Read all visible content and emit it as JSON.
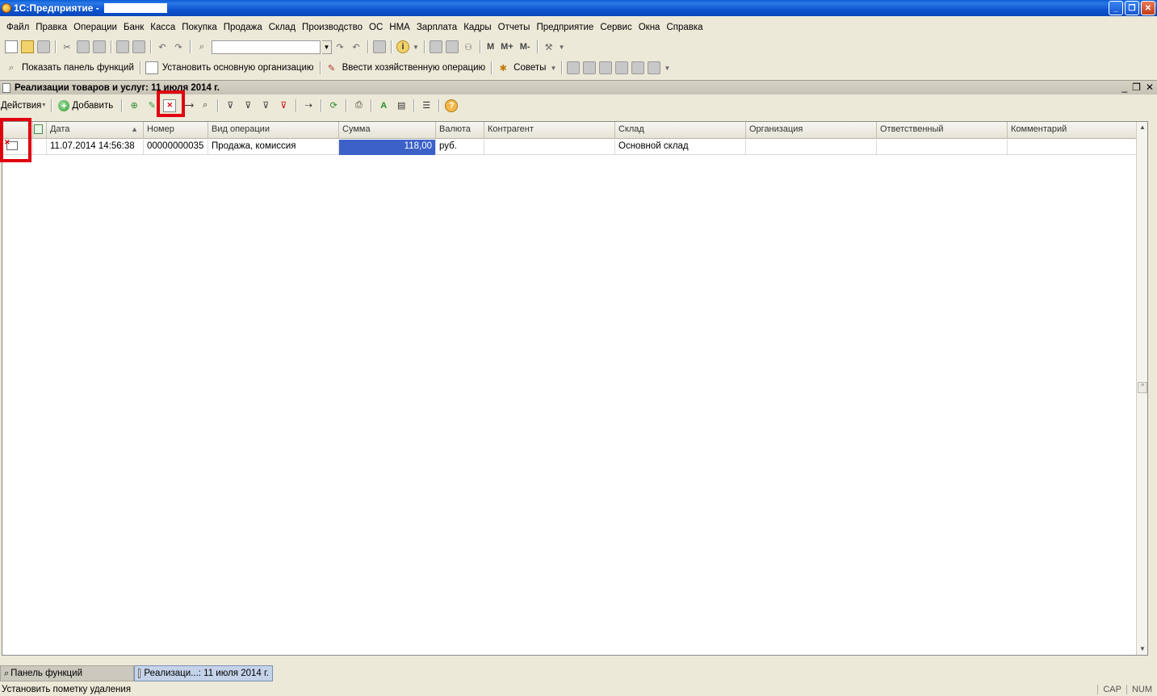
{
  "window": {
    "title": "1С:Предприятие -"
  },
  "menu": [
    "Файл",
    "Правка",
    "Операции",
    "Банк",
    "Касса",
    "Покупка",
    "Продажа",
    "Склад",
    "Производство",
    "ОС",
    "НМА",
    "Зарплата",
    "Кадры",
    "Отчеты",
    "Предприятие",
    "Сервис",
    "Окна",
    "Справка"
  ],
  "toolbar1": {
    "m": "M",
    "mplus": "M+",
    "mminus": "M-"
  },
  "toolbar2": {
    "show_panel": "Показать панель функций",
    "set_org": "Установить основную организацию",
    "enter_op": "Ввести хозяйственную операцию",
    "tips": "Советы"
  },
  "document": {
    "title": "Реализации товаров и услуг: 11 июля 2014 г."
  },
  "commandbar": {
    "actions": "Действия",
    "add": "Добавить"
  },
  "table": {
    "columns": [
      "Дата",
      "Номер",
      "Вид операции",
      "Сумма",
      "Валюта",
      "Контрагент",
      "Склад",
      "Организация",
      "Ответственный",
      "Комментарий"
    ],
    "rows": [
      {
        "date": "11.07.2014 14:56:38",
        "number": "00000000035",
        "operation": "Продажа, комиссия",
        "sum": "118,00",
        "currency": "руб.",
        "counterparty": "",
        "warehouse": "Основной склад",
        "organization": "",
        "responsible": "",
        "comment": ""
      }
    ]
  },
  "taskbar": {
    "task1": "Панель функций",
    "task2": "Реализаци...: 11 июля 2014 г."
  },
  "status": {
    "message": "Установить пометку удаления",
    "cap": "CAP",
    "num": "NUM"
  },
  "colors": {
    "highlight": "#e0000f",
    "selection": "#3c62c9"
  }
}
